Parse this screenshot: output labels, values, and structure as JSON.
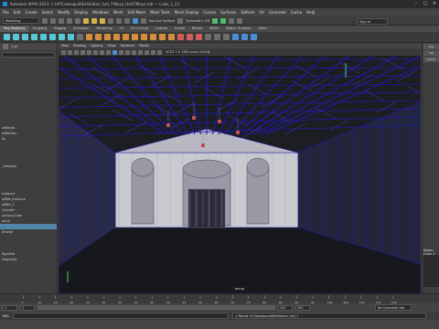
{
  "window": {
    "title": "Autodesk MAYA 2023: C:\\Vl\\Turbosquid\\Exhibition_hall_7\\Maya_Hall7\\Maya.mb  ---  Cube_1_23",
    "controls": [
      "–",
      "□",
      "✕"
    ]
  },
  "menubar": {
    "items": [
      "File",
      "Edit",
      "Create",
      "Select",
      "Modify",
      "Display",
      "Windows",
      "Mesh",
      "Edit Mesh",
      "Mesh Tools",
      "Mesh Display",
      "Curves",
      "Surfaces",
      "Deform",
      "UV",
      "Generate",
      "Cache",
      "Help"
    ]
  },
  "statusline": {
    "mode": "Modeling",
    "no_live_surface": "No Live Surface",
    "symmetry": "Symmetry: Off",
    "sign_in": "Sign In"
  },
  "shelf": {
    "tabs": [
      "Poly Modeling",
      "Sculpting",
      "Rigging",
      "Animation",
      "Rendering",
      "FX",
      "FX Caching",
      "Custom",
      "Arnold",
      "Bifrost",
      "MASH",
      "Motion Graphics",
      "XGen"
    ],
    "active_tab": "Poly Modeling"
  },
  "outliner": {
    "title": "Outl",
    "items": [
      "",
      "",
      "",
      "",
      "",
      "",
      "",
      "",
      "",
      "",
      "",
      "",
      "allBelow",
      "allBottom",
      "ity",
      "",
      "",
      "",
      "",
      "_instance",
      "",
      "",
      "",
      "",
      "instance",
      "allBot_instance",
      "allBot_1",
      "Cylinder",
      "vertical_tube",
      "ancel",
      "",
      "tFrame",
      "",
      "",
      "",
      "RightSet",
      "ObjectSet",
      "",
      ""
    ],
    "selected_index": 30
  },
  "viewport": {
    "menu": [
      "View",
      "Shading",
      "Lighting",
      "Show",
      "Renderer",
      "Panels"
    ],
    "camera_label": "persp",
    "colorspace": "ACES 1.0 SDR-video (sRGB)"
  },
  "attribute_editor": {
    "tabs": [
      "List",
      "Sel",
      "Focus"
    ],
    "notes_label": "Notes: Cube_1"
  },
  "time": {
    "start": "1",
    "end": "120",
    "playback_start": "1",
    "playback_end": "200",
    "character_set": "No Character Set",
    "ticks": [
      "5",
      "10",
      "15",
      "20",
      "25",
      "30",
      "35",
      "40",
      "45",
      "50",
      "55",
      "60",
      "65",
      "70",
      "75",
      "80",
      "85",
      "90",
      "95",
      "100",
      "105",
      "110",
      "115",
      "120"
    ]
  },
  "commandline": {
    "label": "MEL",
    "result": "// Result: D:/Turbosquid/Exhibition_hall_7"
  },
  "colors": {
    "wire": "#1f1aa8",
    "wire_light": "#3f3dd6",
    "wall": "#c9c9d0",
    "wall_dark": "#9a9aa6",
    "bg": "#1d1e22",
    "selected": "#5285a6"
  }
}
